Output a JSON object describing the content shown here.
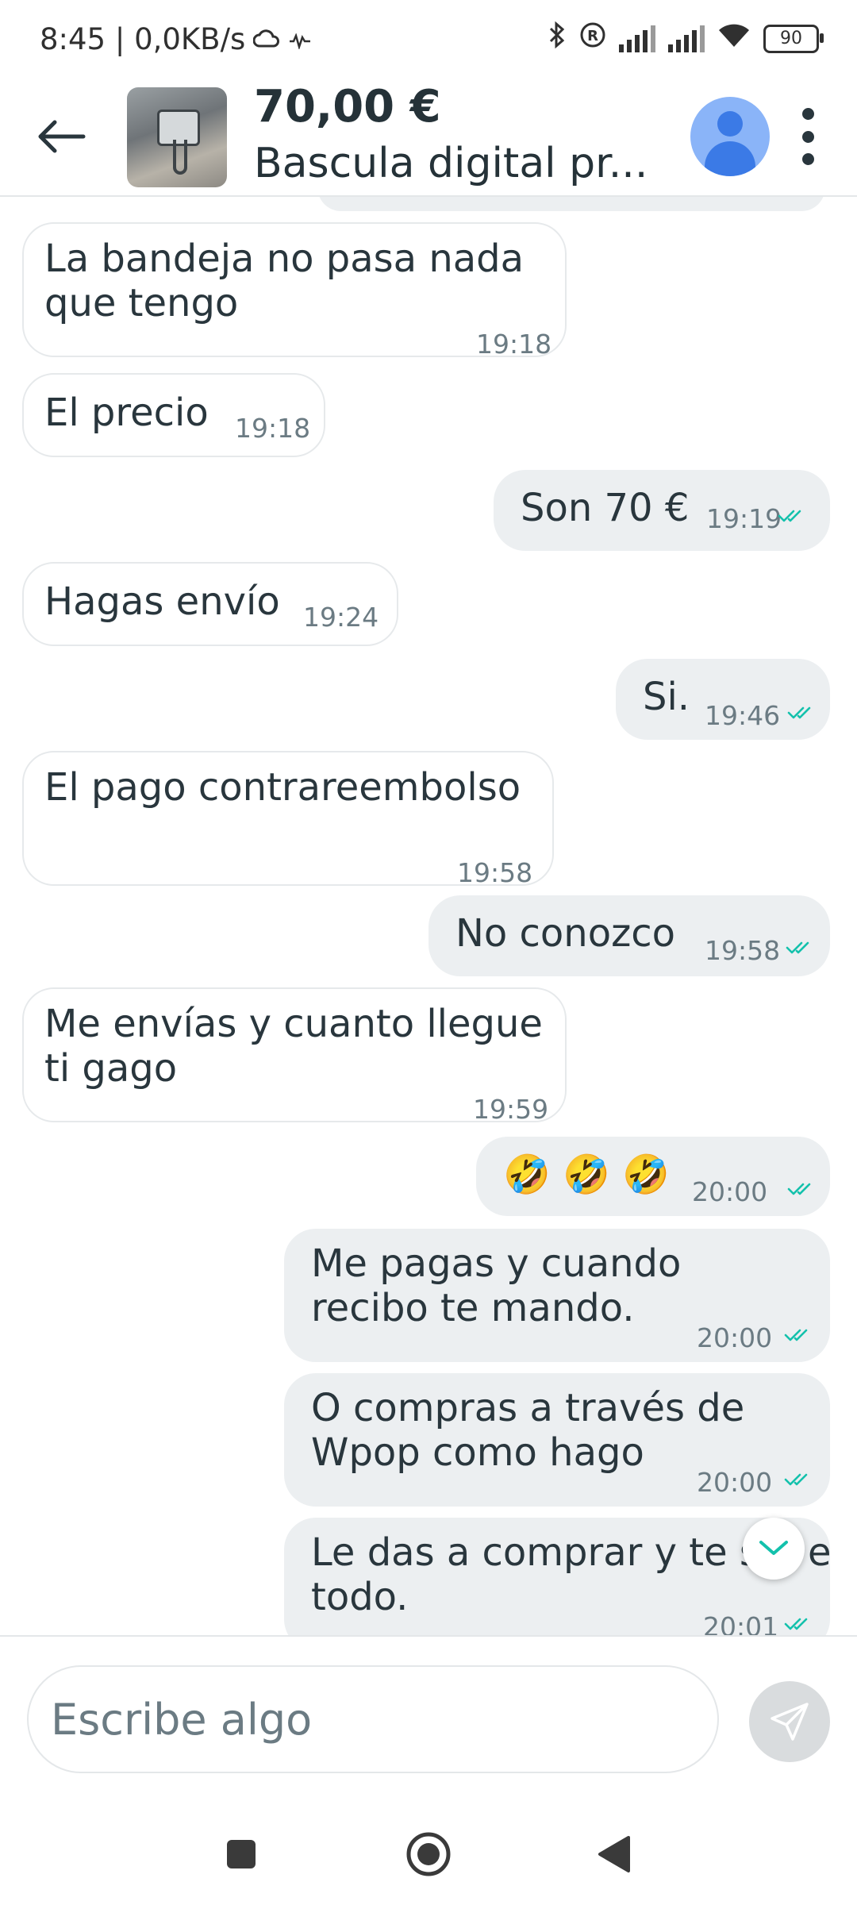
{
  "status_bar": {
    "time_speed": "8:45 | 0,0KB/s",
    "battery": "90"
  },
  "header": {
    "price": "70,00 €",
    "title": "Bascula digital pr...",
    "icons": {
      "back": "back-arrow-icon",
      "menu": "more-vert-icon"
    }
  },
  "messages": [
    {
      "dir": "in",
      "text": "La bandeja no pasa nada\nque tengo",
      "time": "19:18"
    },
    {
      "dir": "in",
      "text": "El precio",
      "time": "19:18"
    },
    {
      "dir": "out",
      "text": "Son 70 €",
      "time": "19:19",
      "read": true
    },
    {
      "dir": "in",
      "text": "Hagas envío",
      "time": "19:24"
    },
    {
      "dir": "out",
      "text": "Si.",
      "time": "19:46",
      "read": true
    },
    {
      "dir": "in",
      "text": "El pago contrareembolso",
      "time": "19:58"
    },
    {
      "dir": "out",
      "text": "No conozco",
      "time": "19:58",
      "read": true
    },
    {
      "dir": "in",
      "text": "Me envías y cuanto llegue\nti gago",
      "time": "19:59"
    },
    {
      "dir": "out",
      "text": "🤣 🤣 🤣",
      "time": "20:00",
      "read": true
    },
    {
      "dir": "out",
      "text": "Me pagas y cuando\nrecibo te mando.",
      "time": "20:00",
      "read": true
    },
    {
      "dir": "out",
      "text": "O compras a través de\nWpop como hago",
      "time": "20:00",
      "read": true
    },
    {
      "dir": "out",
      "text": "Le das a comprar y te s    e\ntodo.",
      "time": "20:01",
      "read": true
    }
  ],
  "compose": {
    "placeholder": "Escribe algo"
  },
  "colors": {
    "read_ticks": "#13c1ac",
    "outgoing_bubble": "#eceff1",
    "avatar_bg": "#8ab4f8"
  }
}
